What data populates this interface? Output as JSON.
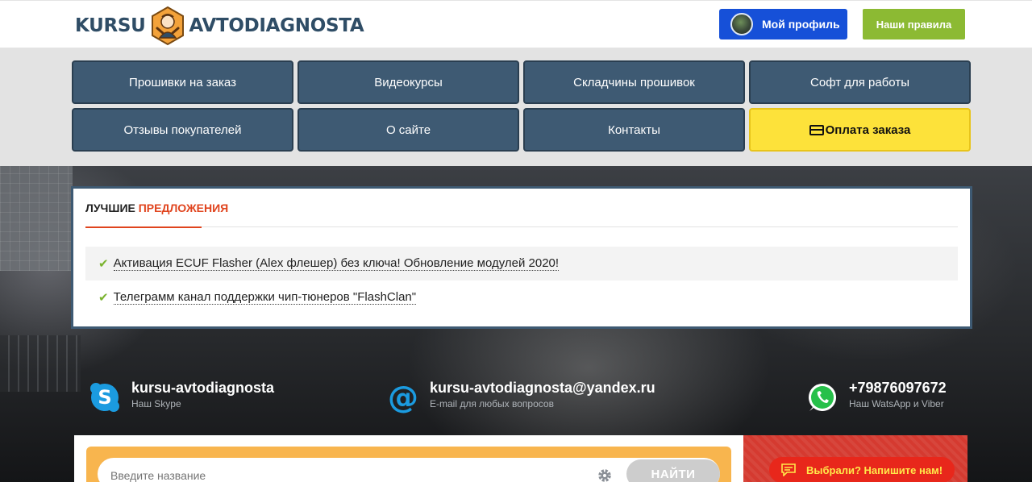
{
  "header": {
    "logo_left": "KURSU",
    "logo_right": "AVTODIAGNOSTA",
    "profile_label": "Мой профиль",
    "rules_label": "Наши правила"
  },
  "nav": {
    "items": [
      {
        "label": "Прошивки на заказ"
      },
      {
        "label": "Видеокурсы"
      },
      {
        "label": "Складчины прошивок"
      },
      {
        "label": "Софт для работы"
      },
      {
        "label": "Отзывы покупателей"
      },
      {
        "label": "О сайте"
      },
      {
        "label": "Контакты"
      },
      {
        "label": "Оплата заказа"
      }
    ]
  },
  "offers": {
    "title_prefix": "ЛУЧШИЕ",
    "title_accent": "ПРЕДЛОЖЕНИЯ",
    "items": [
      {
        "text": "Активация ECUF Flasher (Alex флешер) без ключа! Обновление модулей 2020!"
      },
      {
        "text": "Телеграмм канал поддержки чип-тюнеров \"FlashClan\""
      }
    ]
  },
  "contacts": {
    "skype": {
      "main": "kursu-avtodiagnosta",
      "sub": "Наш Skype",
      "icon": "skype-icon"
    },
    "email": {
      "main": "kursu-avtodiagnosta@yandex.ru",
      "sub": "E-mail для любых вопросов",
      "icon": "at-icon"
    },
    "whatsapp": {
      "main": "+79876097672",
      "sub": "Наш WatsApp и Viber",
      "icon": "whatsapp-icon"
    }
  },
  "search": {
    "placeholder": "Введите название",
    "button_label": "НАЙТИ"
  },
  "chat": {
    "label": "Выбрали? Напишите нам!"
  },
  "colors": {
    "nav_bg": "#3e5a73",
    "pay_bg": "#fde23a",
    "profile_bg": "#1650d8",
    "rules_bg": "#8cba33",
    "accent_red": "#e0441e"
  }
}
